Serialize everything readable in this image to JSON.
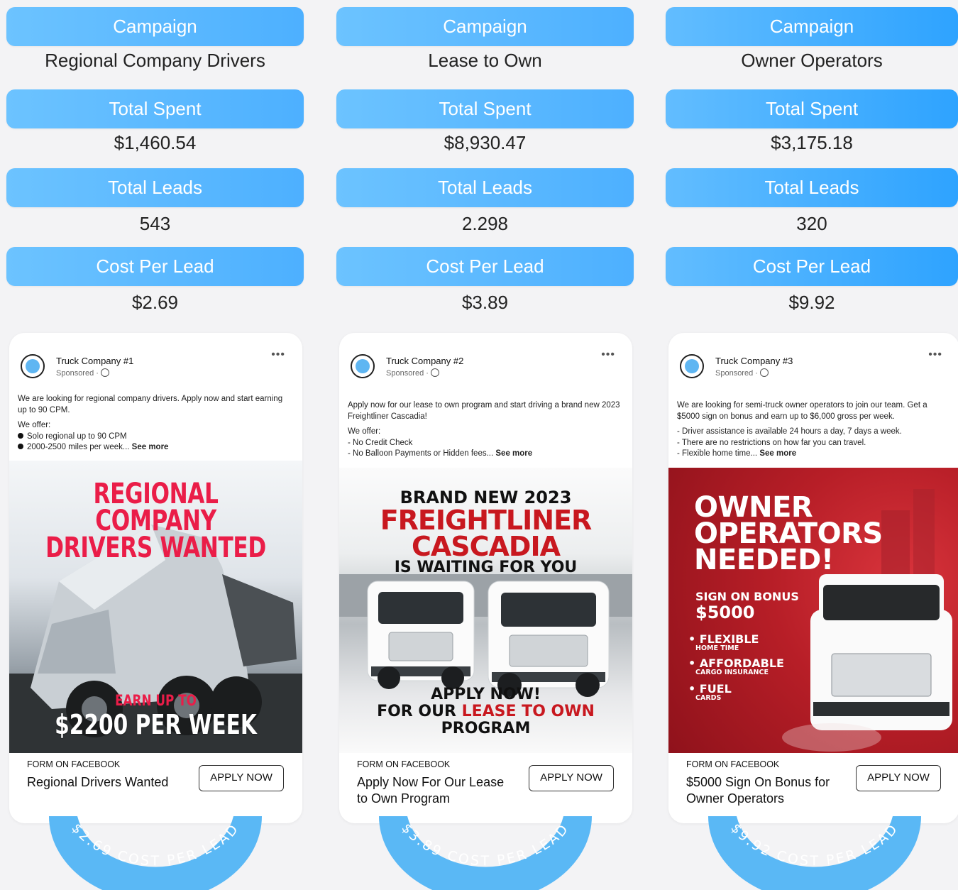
{
  "labels": {
    "campaign": "Campaign",
    "total_spent": "Total Spent",
    "total_leads": "Total Leads",
    "cost_per_lead": "Cost Per Lead",
    "form_on_facebook": "FORM ON FACEBOOK",
    "apply_now": "APPLY NOW",
    "sponsored": "Sponsored ·",
    "more_dots": "•••"
  },
  "campaigns": [
    {
      "name": "Regional Company Drivers",
      "total_spent": "$1,460.54",
      "total_leads": "543",
      "cost_per_lead": "$2.69",
      "company": "Truck Company #1",
      "post_intro": "We are looking for regional company drivers. Apply now and start earning up to 90 CPM.",
      "we_offer": "We offer:",
      "offer_1": "Solo regional up to 90 CPM",
      "offer_2": "2000-2500 miles per week...",
      "see_more": "See more",
      "creative_line1": "REGIONAL COMPANY",
      "creative_line2": "DRIVERS WANTED",
      "creative_line3": "EARN UP TO",
      "creative_line4": "$2200 PER WEEK",
      "cta_title": "Regional Drivers Wanted",
      "badge_text": "$2.69 COST PER LEAD"
    },
    {
      "name": "Lease to Own",
      "total_spent": "$8,930.47",
      "total_leads": "2.298",
      "cost_per_lead": "$3.89",
      "company": "Truck Company #2",
      "post_intro": "Apply now for our lease to own program and start driving a brand new 2023 Freightliner Cascadia!",
      "we_offer": "We offer:",
      "offer_1": "- No Credit Check",
      "offer_2": "- No Balloon Payments or Hidden fees...",
      "see_more": "See more",
      "creative_line1": "BRAND NEW 2023",
      "creative_line2": "FREIGHTLINER",
      "creative_line3": "CASCADIA",
      "creative_line4": "IS WAITING FOR YOU",
      "creative_line5": "APPLY NOW!",
      "creative_line6a": "FOR OUR",
      "creative_line6b": "LEASE TO OWN",
      "creative_line7": "PROGRAM",
      "cta_title": "Apply Now For Our Lease to Own Program",
      "badge_text": "$3.89 COST PER LEAD"
    },
    {
      "name": "Owner Operators",
      "total_spent": "$3,175.18",
      "total_leads": "320",
      "cost_per_lead": "$9.92",
      "company": "Truck Company #3",
      "post_intro": "We are looking for semi-truck owner operators to join our team. Get a $5000 sign on bonus and earn up to $6,000 gross per week.",
      "offer_1": "- Driver assistance is available 24 hours a day, 7 days a week.",
      "offer_2": "- There are no restrictions on how far you can travel.",
      "offer_3": "- Flexible home time...",
      "see_more": "See more",
      "creative_line1": "OWNER",
      "creative_line2": "OPERATORS",
      "creative_line3": "NEEDED!",
      "bonus_label": "SIGN ON BONUS",
      "bonus_value": "$5000",
      "feature_1": "FLEXIBLE",
      "feature_1_sub": "HOME TIME",
      "feature_2": "AFFORDABLE",
      "feature_2_sub": "CARGO INSURANCE",
      "feature_3": "FUEL",
      "feature_3_sub": "CARDS",
      "cta_title": "$5000 Sign On Bonus for Owner Operators",
      "badge_text": "$9.92 COST PER LEAD"
    }
  ],
  "colors": {
    "pill": "#4db0ff",
    "badge": "#5ab8f5",
    "creative_red": "#ea1d48",
    "background": "#f3f3f5"
  }
}
